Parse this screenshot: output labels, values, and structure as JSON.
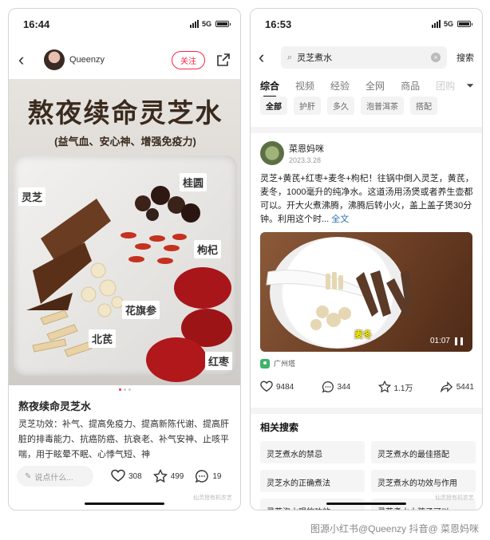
{
  "left": {
    "status": {
      "time": "16:44",
      "net": "5G"
    },
    "author": {
      "name": "Queenzy",
      "follow_label": "关注"
    },
    "photo": {
      "title": "熬夜续命灵芝水",
      "subtitle": "(益气血、安心神、增强免疫力)",
      "labels": [
        "灵芝",
        "桂圆",
        "枸杞",
        "花旗参",
        "北芪",
        "红枣"
      ]
    },
    "post": {
      "title": "熬夜续命灵芝水",
      "body": "灵芝功效：补气、提高免疫力、提高新陈代谢、提高肝脏的排毒能力、抗癌防癌、抗衰老、补气安神、止咳平喘，用于眩晕不眠、心悸气短、神"
    },
    "bar": {
      "comment_placeholder": "说点什么...",
      "likes": "308",
      "stars": "499",
      "comments": "19"
    },
    "watermark": "仙灵授有机农艺"
  },
  "right": {
    "status": {
      "time": "16:53",
      "net": "5G"
    },
    "search": {
      "query": "灵芝煮水",
      "button": "搜索"
    },
    "tabs": [
      "综合",
      "视频",
      "经验",
      "全网",
      "商品",
      "团购"
    ],
    "chips": [
      "全部",
      "护肝",
      "多久",
      "泡普洱茶",
      "搭配"
    ],
    "post": {
      "author": "菜恩妈咪",
      "date": "2023.3.28",
      "text": "灵芝+黄芪+红枣+麦冬+枸杞！往锅中倒入灵芝，黄芪，麦冬，1000毫升的纯净水。这道汤用汤煲或者养生壶都可以。开大火煮沸腾，沸腾后转小火，盖上盖子煲30分钟。利用这个时...",
      "more": "全文",
      "video_caption": "麦冬",
      "video_time": "01:07",
      "location": "广州塔",
      "likes": "9484",
      "comments": "344",
      "stars": "1.1万",
      "shares": "5441"
    },
    "related_title": "相关搜索",
    "related": [
      "灵芝煮水的禁忌",
      "灵芝煮水的最佳搭配",
      "灵芝水的正确煮法",
      "灵芝煮水的功效与作用",
      "灵芝泡水喝的功效",
      "灵芝煮水小孩子可以"
    ],
    "watermark": "仙灵授有机农艺"
  },
  "credit": "图源小红书@Queenzy 抖音@ 菜恩妈咪",
  "colors": {
    "accent": "#ff2442",
    "link": "#2b6cb0",
    "location": "#3fb36b"
  }
}
